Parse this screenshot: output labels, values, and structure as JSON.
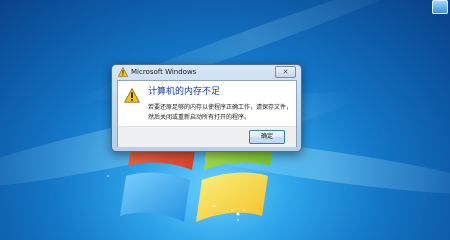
{
  "desktop": {
    "wallpaper": "windows-7-default"
  },
  "dialog": {
    "title": "Microsoft Windows",
    "close_label": "✕",
    "instruction": "计算机的内存不足",
    "message_line1": "若要还原足够的内存以使程序正确工作，请保存文件，",
    "message_line2": "然后关闭或重新启动所有打开的程序。",
    "ok_label": "确定",
    "icon": "warning-icon"
  },
  "colors": {
    "instruction_text": "#1a3aa8",
    "warning_yellow": "#f7c21a",
    "dialog_frame": "#c6d9ef"
  }
}
